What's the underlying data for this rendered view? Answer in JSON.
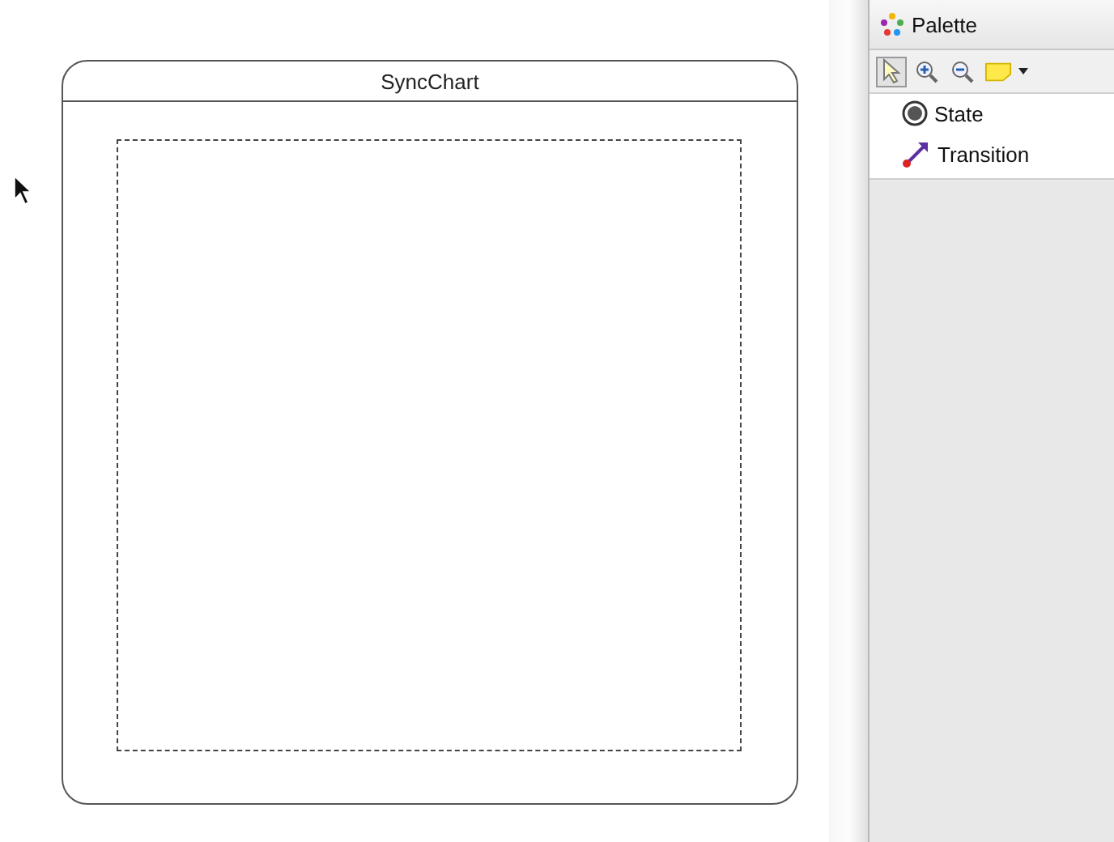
{
  "diagram": {
    "title": "SyncChart"
  },
  "palette": {
    "title": "Palette",
    "tools": [
      {
        "kind": "select",
        "selected": true
      },
      {
        "kind": "zoom-in",
        "selected": false
      },
      {
        "kind": "zoom-out",
        "selected": false
      },
      {
        "kind": "note",
        "selected": false
      }
    ],
    "entries": [
      {
        "kind": "state",
        "label": "State"
      },
      {
        "kind": "transition",
        "label": "Transition"
      }
    ]
  }
}
